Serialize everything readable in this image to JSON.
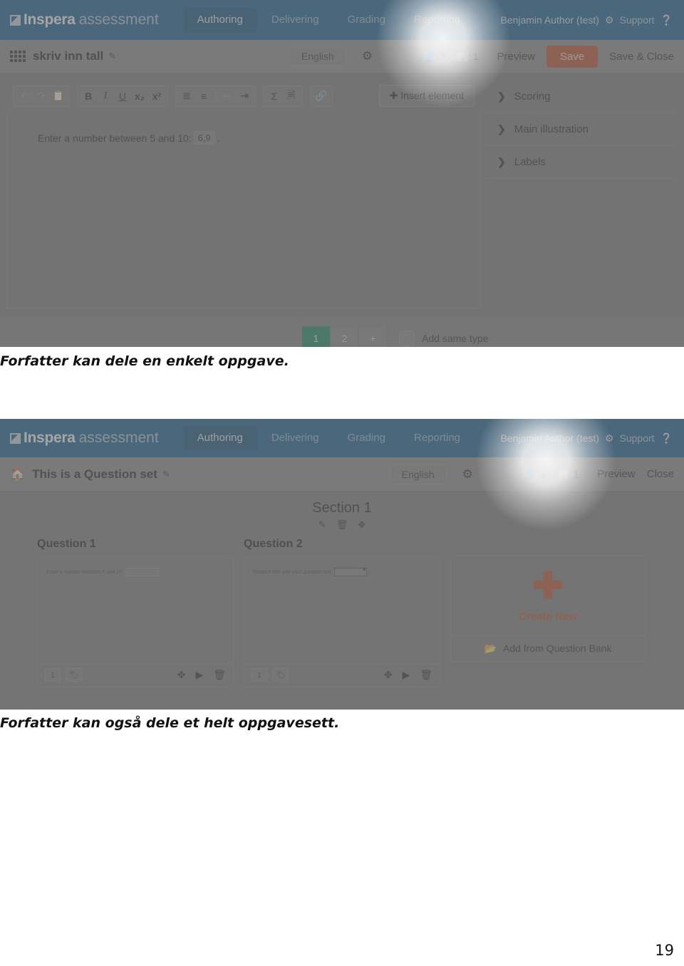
{
  "brand": {
    "strong": "Inspera",
    "light": "assessment",
    "accent": "#125e94",
    "orange": "#c1502e",
    "green": "#138a63"
  },
  "nav": {
    "tabs": [
      {
        "label": "Authoring",
        "active": true
      },
      {
        "label": "Delivering",
        "active": false
      },
      {
        "label": "Grading",
        "active": false
      },
      {
        "label": "Reporting",
        "active": false
      }
    ],
    "user": "Benjamin Author (test)",
    "gear_icon": "gear-icon",
    "support": "Support",
    "help_icon": "help-circle-icon"
  },
  "shot1": {
    "grid_icon": "grid-icon",
    "title": "skriv inn tall",
    "edit_icon": "pencil-icon",
    "language": "English",
    "settings_icon": "gear-icon",
    "counters": [
      {
        "icon": "user-icon",
        "value": "3"
      },
      {
        "icon": "building-icon",
        "value": "1"
      }
    ],
    "actions": {
      "preview": "Preview",
      "save": "Save",
      "save_close": "Save & Close"
    },
    "toolbar": {
      "groups": [
        {
          "buttons": [
            {
              "icon": "undo-icon",
              "glyph": "↰",
              "dim": true
            },
            {
              "icon": "redo-icon",
              "glyph": "↱",
              "dim": true
            },
            {
              "icon": "paste-icon",
              "glyph": "❏",
              "dim": false
            }
          ]
        },
        {
          "buttons": [
            {
              "icon": "bold-icon",
              "glyph": "B",
              "dim": false
            },
            {
              "icon": "italic-icon",
              "glyph": "I",
              "dim": false
            },
            {
              "icon": "underline-icon",
              "glyph": "U",
              "dim": false
            },
            {
              "icon": "subscript-icon",
              "glyph": "x₂",
              "dim": false
            },
            {
              "icon": "superscript-icon",
              "glyph": "x²",
              "dim": false
            }
          ]
        },
        {
          "buttons": [
            {
              "icon": "numbered-list-icon",
              "glyph": "⒈≡",
              "dim": false
            },
            {
              "icon": "bulleted-list-icon",
              "glyph": "⁞≡",
              "dim": false
            },
            {
              "icon": "outdent-icon",
              "glyph": "⇤",
              "dim": true
            },
            {
              "icon": "indent-icon",
              "glyph": "⇥",
              "dim": false
            }
          ]
        },
        {
          "buttons": [
            {
              "icon": "math-sigma-icon",
              "glyph": "Σ",
              "dim": false
            },
            {
              "icon": "document-icon",
              "glyph": "🗋",
              "dim": false
            }
          ]
        },
        {
          "buttons": [
            {
              "icon": "link-icon",
              "glyph": "🔗",
              "dim": false
            }
          ]
        }
      ],
      "insert_element": "Insert element",
      "insert_plus_icon": "plus-icon"
    },
    "content": {
      "prompt": "Enter a number between 5 and 10:",
      "answer_value": "6,9",
      "period": "."
    },
    "panel": [
      {
        "label": "Scoring",
        "icon": "chevron-right-icon"
      },
      {
        "label": "Main illustration",
        "icon": "chevron-right-icon"
      },
      {
        "label": "Labels",
        "icon": "chevron-right-icon"
      }
    ],
    "pagestrip": {
      "tabs": [
        {
          "label": "1",
          "selected": true
        },
        {
          "label": "2",
          "selected": false
        },
        {
          "label": "+",
          "selected": false
        }
      ],
      "checkbox_icon": "checkbox-icon",
      "add_same_type": "Add same type"
    }
  },
  "shot2": {
    "home_icon": "home-icon",
    "title": "This is a Question set",
    "edit_icon": "pencil-icon",
    "language": "English",
    "settings_icon": "gear-icon",
    "counters": [
      {
        "icon": "user-icon",
        "value": "3"
      },
      {
        "icon": "building-icon",
        "value": "1"
      }
    ],
    "actions": {
      "preview": "Preview",
      "close": "Close"
    },
    "section": {
      "title": "Section 1",
      "tools": [
        {
          "icon": "pencil-icon",
          "glyph": "✎"
        },
        {
          "icon": "trash-icon",
          "glyph": "🗑"
        },
        {
          "icon": "move-icon",
          "glyph": "✥"
        }
      ]
    },
    "questions": [
      {
        "title": "Question 1",
        "preview_text": "Enter a number between 5 and 10:",
        "field_type": "text-input",
        "score": "1",
        "tag_icon": "tag-icon",
        "tools": [
          {
            "icon": "move-icon",
            "glyph": "✥"
          },
          {
            "icon": "play-icon",
            "glyph": "▶"
          },
          {
            "icon": "trash-icon",
            "glyph": "🗑"
          }
        ]
      },
      {
        "title": "Question 2",
        "preview_text": "Replace this with your question text",
        "field_type": "dropdown",
        "score": "1",
        "tag_icon": "tag-icon",
        "tools": [
          {
            "icon": "move-icon",
            "glyph": "✥"
          },
          {
            "icon": "play-icon",
            "glyph": "▶"
          },
          {
            "icon": "trash-icon",
            "glyph": "🗑"
          }
        ]
      }
    ],
    "create_card": {
      "plus_icon": "plus-icon",
      "label": "Create New",
      "bank_icon": "folder-open-icon",
      "bank_label": "Add from Question Bank"
    }
  },
  "captions": {
    "one": "Forfatter kan dele en enkelt oppgave.",
    "two": "Forfatter kan også dele et helt oppgavesett."
  },
  "page_number": "19"
}
